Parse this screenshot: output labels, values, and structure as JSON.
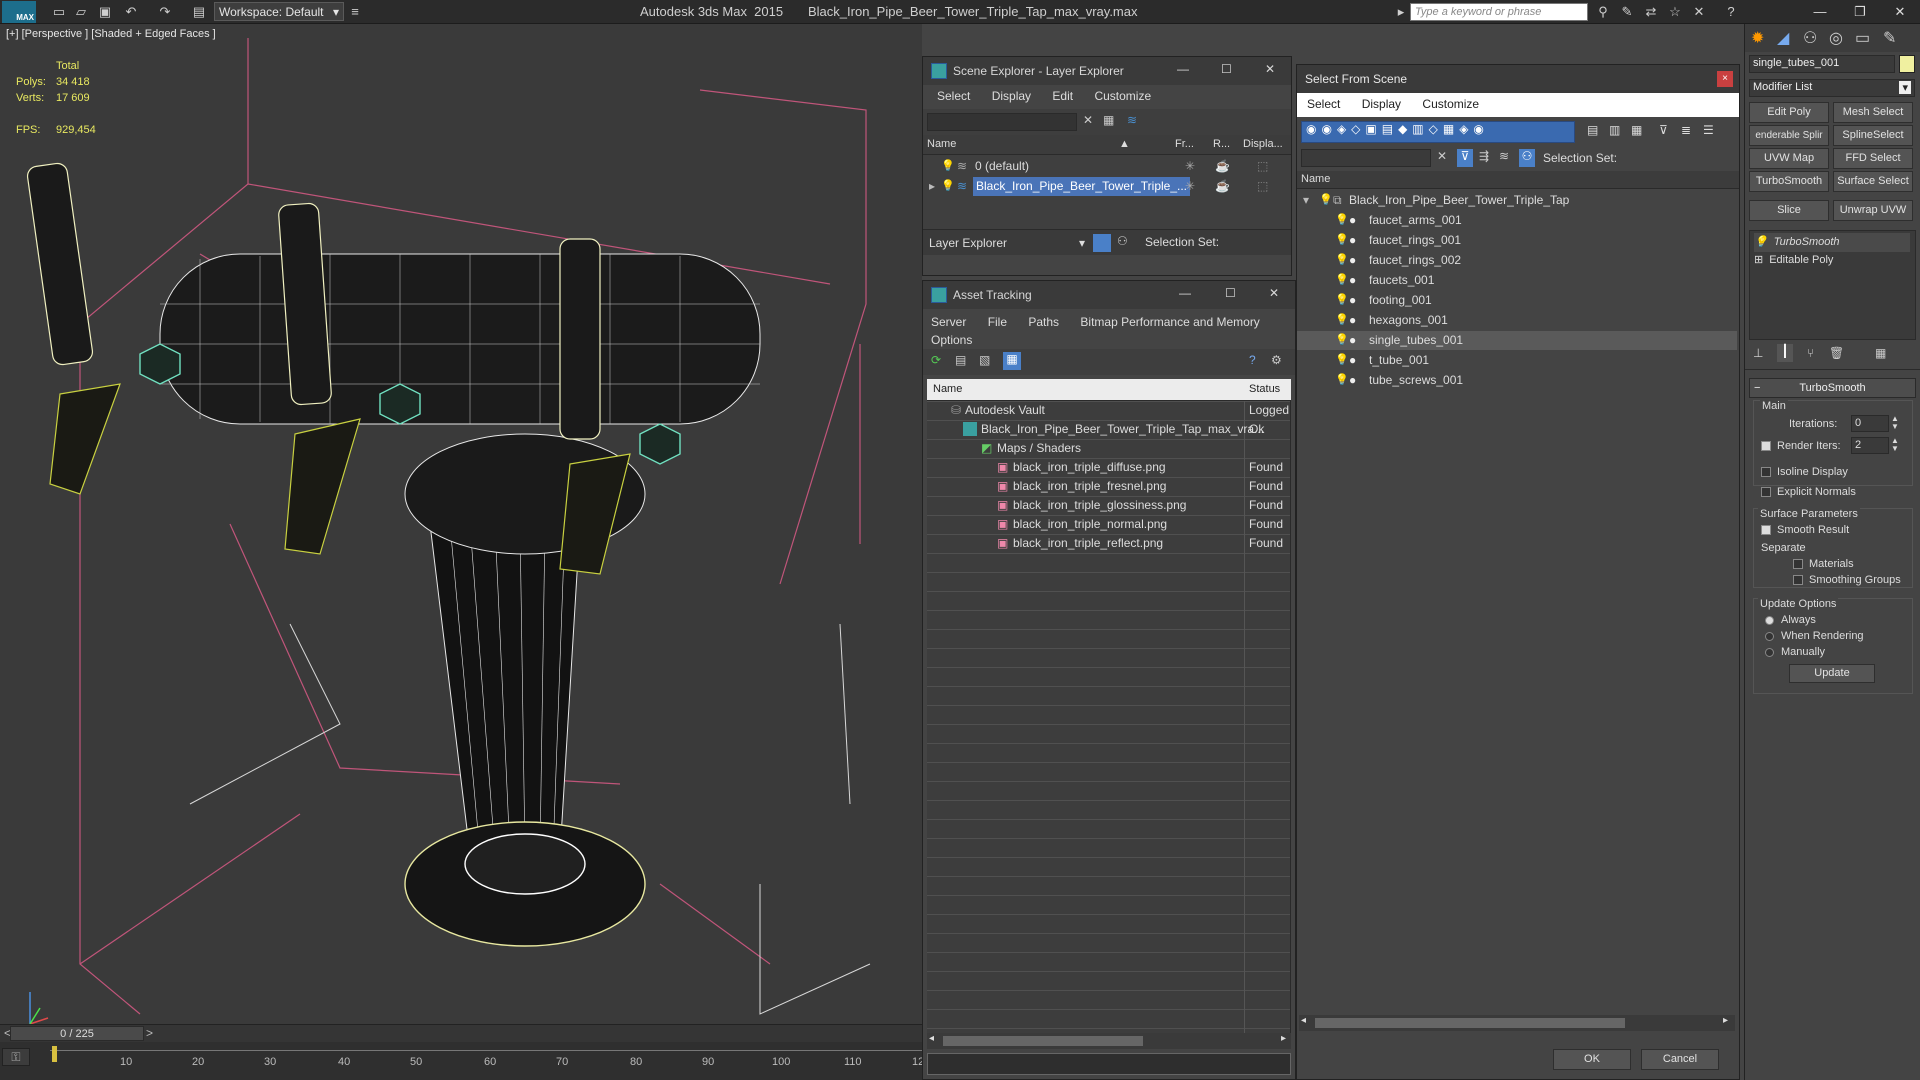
{
  "titlebar": {
    "app_title": "Autodesk 3ds Max  2015",
    "file_name": "Black_Iron_Pipe_Beer_Tower_Triple_Tap_max_vray.max",
    "logo_text": "MAX",
    "workspace": "Workspace: Default",
    "search_placeholder": "Type a keyword or phrase"
  },
  "viewport": {
    "label": "[+] [Perspective ] [Shaded + Edged Faces ]",
    "stats_header": "Total",
    "polys_label": "Polys:",
    "polys_value": "34 418",
    "verts_label": "Verts:",
    "verts_value": "17 609",
    "fps_label": "FPS:",
    "fps_value": "929,454"
  },
  "timeline": {
    "frame_counter": "0 / 225",
    "ticks": [
      "10",
      "20",
      "30",
      "40",
      "50",
      "60",
      "70",
      "80",
      "90",
      "100",
      "110",
      "12"
    ]
  },
  "scene_explorer": {
    "title": "Scene Explorer - Layer Explorer",
    "menu": [
      "Select",
      "Display",
      "Edit",
      "Customize"
    ],
    "columns": [
      "Name",
      "Fr...",
      "R...",
      "Displa..."
    ],
    "rows": [
      "0 (default)",
      "Black_Iron_Pipe_Beer_Tower_Triple_..."
    ],
    "footer_dropdown": "Layer Explorer",
    "selection_set_label": "Selection Set:"
  },
  "asset_tracking": {
    "title": "Asset Tracking",
    "menu": [
      "Server",
      "File",
      "Paths",
      "Bitmap Performance and Memory",
      "Options"
    ],
    "columns": [
      "Name",
      "Status"
    ],
    "rows": [
      {
        "name": "Autodesk Vault",
        "status": "Logged"
      },
      {
        "name": "Black_Iron_Pipe_Beer_Tower_Triple_Tap_max_vra...",
        "status": "Ok"
      },
      {
        "name": "Maps / Shaders",
        "status": ""
      },
      {
        "name": "black_iron_triple_diffuse.png",
        "status": "Found"
      },
      {
        "name": "black_iron_triple_fresnel.png",
        "status": "Found"
      },
      {
        "name": "black_iron_triple_glossiness.png",
        "status": "Found"
      },
      {
        "name": "black_iron_triple_normal.png",
        "status": "Found"
      },
      {
        "name": "black_iron_triple_reflect.png",
        "status": "Found"
      }
    ]
  },
  "select_from_scene": {
    "title": "Select From Scene",
    "menu": [
      "Select",
      "Display",
      "Customize"
    ],
    "selection_set_label": "Selection Set:",
    "column": "Name",
    "root": "Black_Iron_Pipe_Beer_Tower_Triple_Tap",
    "items": [
      "faucet_arms_001",
      "faucet_rings_001",
      "faucet_rings_002",
      "faucets_001",
      "footing_001",
      "hexagons_001",
      "single_tubes_001",
      "t_tube_001",
      "tube_screws_001"
    ],
    "ok_label": "OK",
    "cancel_label": "Cancel"
  },
  "command_panel": {
    "object_name": "single_tubes_001",
    "modifier_list": "Modifier List",
    "buttons": [
      "Edit Poly",
      "Mesh Select",
      "enderable Splir",
      "SplineSelect",
      "UVW Map",
      "FFD Select",
      "TurboSmooth",
      "Surface Select",
      "Slice",
      "Unwrap UVW"
    ],
    "stack": [
      "TurboSmooth",
      "Editable Poly"
    ],
    "rollout_title": "TurboSmooth",
    "main_label": "Main",
    "iterations_label": "Iterations:",
    "iterations_value": "0",
    "render_iters_label": "Render Iters:",
    "render_iters_value": "2",
    "isoline_label": "Isoline Display",
    "explicit_normals_label": "Explicit Normals",
    "surface_params_label": "Surface Parameters",
    "smooth_result_label": "Smooth Result",
    "separate_label": "Separate",
    "materials_label": "Materials",
    "smoothing_groups_label": "Smoothing Groups",
    "update_options_label": "Update Options",
    "always_label": "Always",
    "when_rendering_label": "When Rendering",
    "manually_label": "Manually",
    "update_button": "Update"
  }
}
